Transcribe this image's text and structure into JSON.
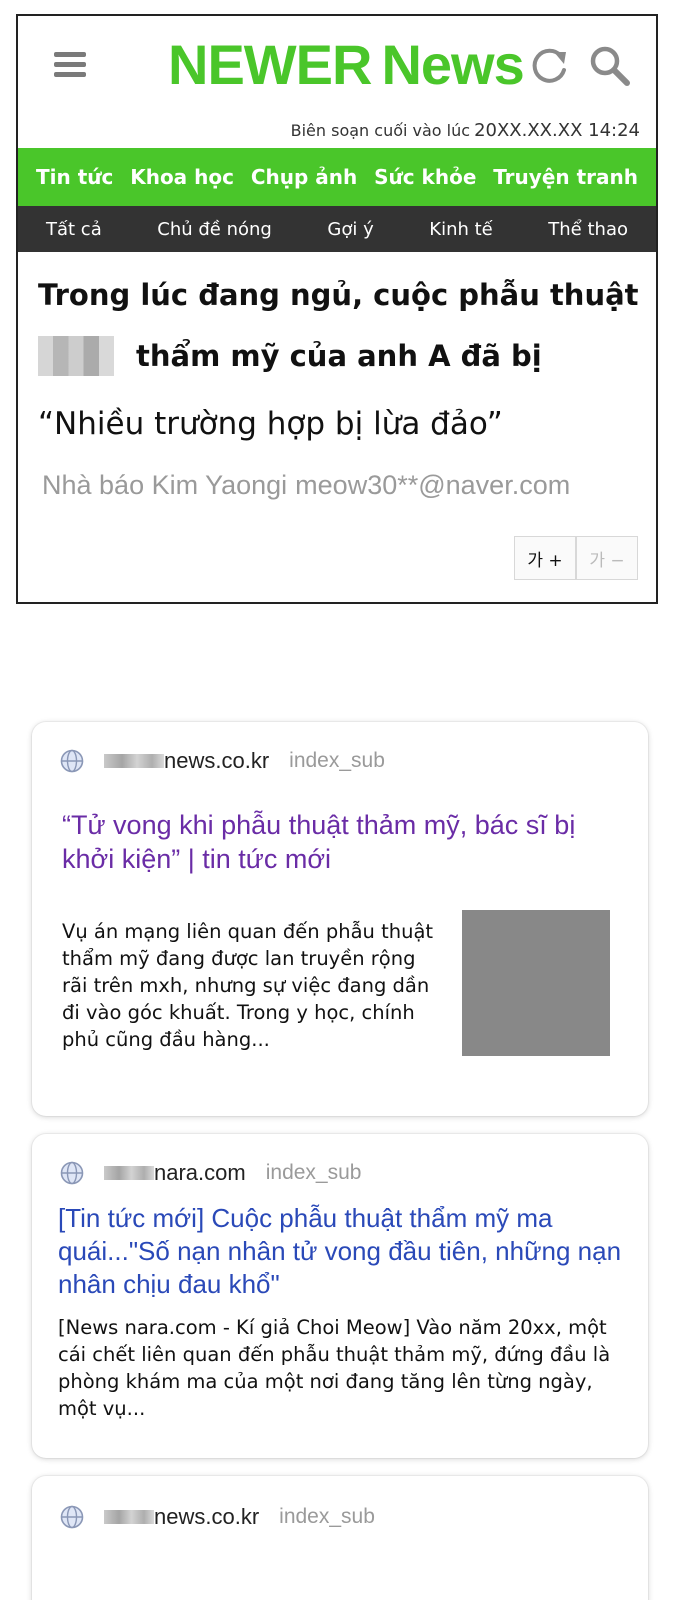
{
  "app": {
    "logo_part1": "NEWER",
    "logo_part2": "News",
    "edit_label": "Biên soạn cuối vào lúc",
    "edit_stamp": "20XX.XX.XX  14:24",
    "brand_color": "#4ac62a"
  },
  "categories": [
    "Tin tức",
    "Khoa học",
    "Chụp ảnh",
    "Sức khỏe",
    "Truyện tranh"
  ],
  "subcategories": [
    "Tất cả",
    "Chủ đề nóng",
    "Gợi ý",
    "Kinh tế",
    "Thể thao"
  ],
  "article": {
    "headline_line1": "Trong lúc đang ngủ, cuộc phẫu thuật",
    "headline_line2": "thẩm mỹ của anh A đã bị",
    "subhead": "“Nhiều trường hợp bị lừa đảo”",
    "author": "Nhà báo Kim Yaongi",
    "email": "meow30**@naver.com",
    "font_increase": "가 +",
    "font_decrease": "가 −"
  },
  "results": [
    {
      "domain": "news.co.kr",
      "subpath": "index_sub",
      "title": "“Tử vong khi phẫu thuật thảm mỹ, bác sĩ bị khởi kiện” | tin tức mới",
      "snippet": "Vụ án mạng liên quan đến phẫu thuật thẩm mỹ đang được lan truyền rộng rãi trên mxh, nhưng sự việc đang dần đi vào góc khuất. Trong y học, chính phủ cũng đầu hàng..."
    },
    {
      "domain": "nara.com",
      "subpath": "index_sub",
      "title": "[Tin tức mới] Cuộc phẫu thuật thẩm mỹ ma quái...\"Số nạn nhân tử vong đầu tiên, những nạn nhân chịu đau khổ\"",
      "snippet": "[News nara.com - Kí giả Choi Meow] Vào năm 20xx, một cái chết liên quan đến phẫu thuật thảm mỹ, đứng đầu là phòng khám ma của một nơi đang tăng lên từng ngày, một vụ..."
    },
    {
      "domain": "news.co.kr",
      "subpath": "index_sub"
    }
  ],
  "icons": [
    "menu-icon",
    "refresh-icon",
    "search-icon",
    "globe-icon"
  ]
}
